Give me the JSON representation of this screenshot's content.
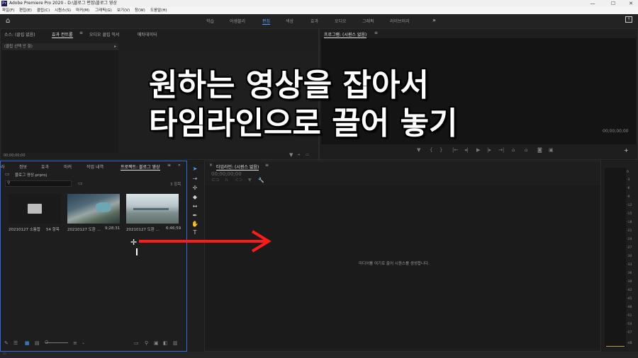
{
  "window": {
    "app_icon": "Pr",
    "title": "Adobe Premiere Pro 2020 - D:\\블로그 편집\\블로그 영상",
    "minimize": "—",
    "maximize": "☐",
    "close": "✕"
  },
  "menu": [
    "파일(F)",
    "편집(E)",
    "클립(C)",
    "시퀀스(S)",
    "마커(M)",
    "그래픽(G)",
    "보기(V)",
    "창(W)",
    "도움말(H)"
  ],
  "workspaces": [
    "학습",
    "어셈블리",
    "편집",
    "색상",
    "효과",
    "오디오",
    "그래픽",
    "라이브러리"
  ],
  "active_workspace": "편집",
  "source_panel": {
    "tabs": [
      "소스: (클립 없음)",
      "효과 컨트롤",
      "오디오 클립 믹서",
      "메타데이터"
    ],
    "active_tab": "효과 컨트롤",
    "no_clip": "(클립 선택 안 함)",
    "timecode": "00;00;00;00"
  },
  "program_panel": {
    "title": "프로그램: (시퀀스 없음)",
    "timecode": "00;00;00;00"
  },
  "project_panel": {
    "tabs": [
      "라",
      "정보",
      "효과",
      "마커",
      "작업 내역",
      "프로젝트: 블로그 영상"
    ],
    "active_tab": "프로젝트: 블로그 영상",
    "project_file": "블로그 영상.prproj",
    "item_count": "3 항목",
    "items": [
      {
        "name": "20210127 소통합",
        "meta": "54 항목"
      },
      {
        "name": "20210127 도환 ...",
        "meta": "9;28;31"
      },
      {
        "name": "20210127 도환 ...",
        "meta": "6;46;59"
      }
    ]
  },
  "timeline_panel": {
    "title": "타임라인: (시퀀스 없음)",
    "timecode": "00;00;00;00",
    "drop_hint": "미디어를 여기로 끌어 시퀀스를 생성합니다."
  },
  "audio_meter": {
    "labels": [
      "0",
      "-3",
      "-6",
      "-9",
      "-12",
      "-15",
      "-18",
      "-21",
      "-24",
      "-27",
      "-30",
      "-33",
      "-36",
      "-39",
      "-42",
      "-45",
      "-48",
      "-51",
      "-54",
      "-57",
      "-dB"
    ]
  },
  "overlay": {
    "line1": "원하는 영상을 잡아서",
    "line2": "타임라인으로 끌어 놓기"
  },
  "colors": {
    "accent": "#4aa3ff",
    "arrow": "#ff1a1a"
  }
}
